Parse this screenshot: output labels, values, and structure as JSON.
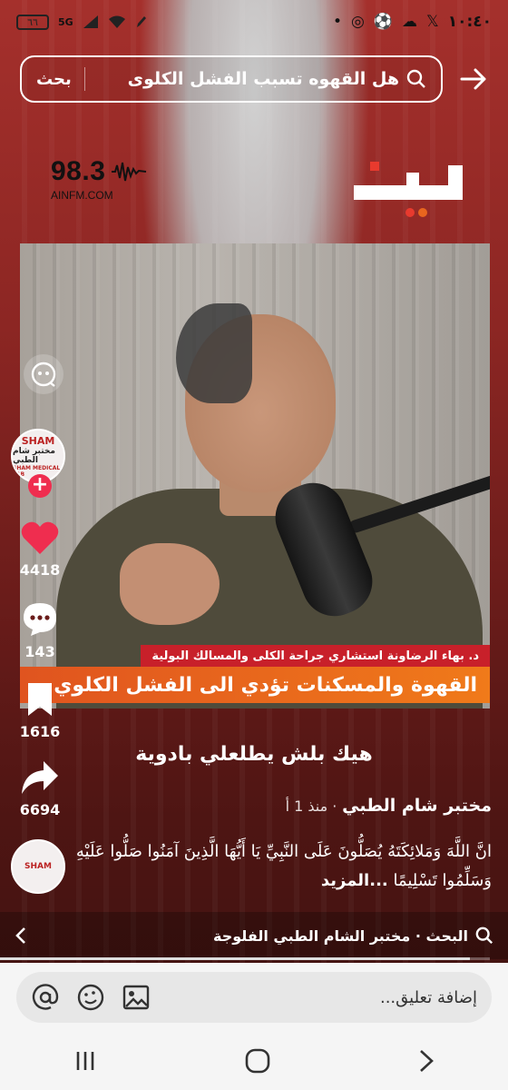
{
  "status_bar": {
    "battery": "٦٦",
    "network": "5G",
    "time": "١٠:٤٠"
  },
  "search": {
    "query": "هل القهوه تسبب الفشل الكلوى",
    "button_label": "بحث"
  },
  "radio_logo": {
    "frequency": "98.3",
    "url": "AINFM.COM"
  },
  "video": {
    "caption_top": "د. بهاء الرضاونة استشاري جراحة الكلى والمسالك البولية",
    "caption_main": "القهوة والمسكنات تؤدي الى الفشل الكلوي"
  },
  "overlay_title": "هيك بلش يطلعلي بادوية",
  "actions": {
    "likes": "4418",
    "comments": "143",
    "saves": "1616",
    "shares": "6694"
  },
  "avatar_text": {
    "line1": "SHAM",
    "line2": "مختبر شام الطبي",
    "line3": "SHAM MEDICAL LAB"
  },
  "author": {
    "name": "مختبر شام الطبي",
    "meta": "· منذ 1 أ"
  },
  "description": {
    "text": "انَّ اللَّهَ وَمَلائِكَتَهُ يُصَلُّونَ عَلَى النَّبِيِّ يَا أَيُّهَا الَّذِينَ آمَنُوا صَلُّوا عَلَيْهِ وَسَلِّمُوا تَسْلِيمًا",
    "more": "...المزيد"
  },
  "related_search": {
    "label": "البحث · مختبر الشام الطبي الفلوجة",
    "progress": 0.96
  },
  "comment": {
    "placeholder": "إضافة تعليق..."
  },
  "colors": {
    "like": "#ef2d4f",
    "caption_red": "#c8202a",
    "caption_orange": "#f07a1a"
  }
}
